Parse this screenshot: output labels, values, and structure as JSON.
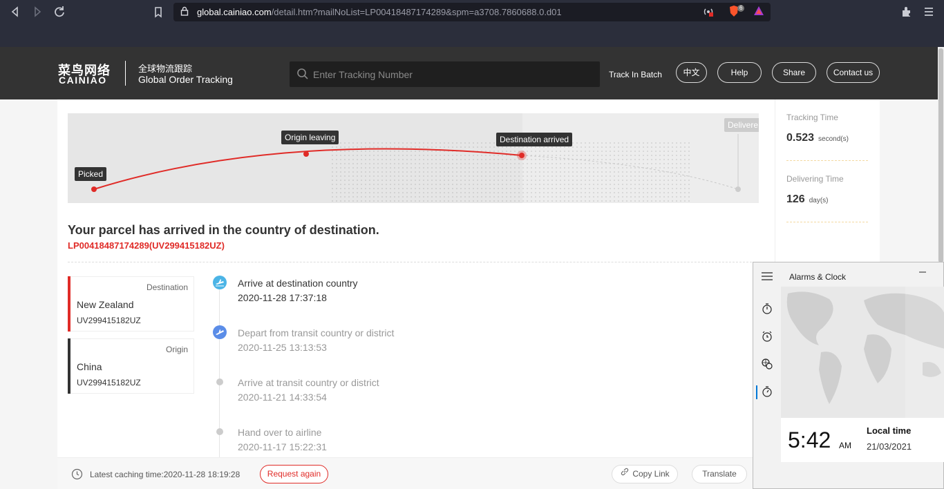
{
  "browser": {
    "url_domain": "global.cainiao.com",
    "url_path": "/detail.htm?mailNoList=LP00418487174289&spm=a3708.7860688.0.d01",
    "shield_count": "6"
  },
  "header": {
    "logo_cn": "菜鸟网络",
    "logo_en": "CAINIAO",
    "tagline_cn": "全球物流跟踪",
    "tagline_en": "Global Order Tracking",
    "search_placeholder": "Enter Tracking Number",
    "track_batch": "Track In Batch",
    "lang_button": "中文",
    "help_button": "Help",
    "share_button": "Share",
    "contact_button": "Contact us"
  },
  "route": {
    "steps": [
      "Picked",
      "Origin leaving",
      "Destination arrived",
      "Delivere"
    ],
    "route_color": "#e02b27"
  },
  "metrics": {
    "tracking_label": "Tracking Time",
    "tracking_value": "0.523",
    "tracking_unit": "second(s)",
    "delivering_label": "Delivering Time",
    "delivering_value": "126",
    "delivering_unit": "day(s)"
  },
  "status": {
    "title": "Your parcel has arrived in the country of destination.",
    "tracking_numbers": "LP00418487174289(UV299415182UZ)"
  },
  "locations": [
    {
      "type": "Destination",
      "country": "New Zealand",
      "code": "UV299415182UZ",
      "color": "#e02b27"
    },
    {
      "type": "Origin",
      "country": "China",
      "code": "UV299415182UZ",
      "color": "#333333"
    }
  ],
  "events": [
    {
      "title": "Arrive at destination country",
      "time": "2020-11-28 17:37:18",
      "icon": "plane-landing-icon",
      "color": "#333333"
    },
    {
      "title": "Depart from transit country or district",
      "time": "2020-11-25 13:13:53",
      "icon": "plane-takeoff-icon",
      "color": "#999999"
    },
    {
      "title": "Arrive at transit country or district",
      "time": "2020-11-21 14:33:54",
      "icon": "dot-icon",
      "color": "#999999"
    },
    {
      "title": "Hand over to airline",
      "time": "2020-11-17 15:22:31",
      "icon": "dot-icon",
      "color": "#999999"
    }
  ],
  "footer": {
    "cache_text": "Latest caching time:2020-11-28 18:19:28",
    "request_again": "Request again",
    "copy_link": "Copy Link",
    "translate": "Translate"
  },
  "alarms_clock": {
    "title": "Alarms & Clock",
    "time": "5:42",
    "ampm": "AM",
    "label": "Local time",
    "date": "21/03/2021"
  }
}
